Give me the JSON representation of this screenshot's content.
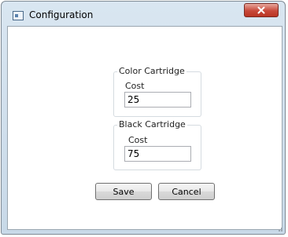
{
  "window": {
    "title": "Configuration"
  },
  "color_cartridge": {
    "legend": "Color Cartridge",
    "cost_label": "Cost",
    "cost_value": "25"
  },
  "black_cartridge": {
    "legend": "Black Cartridge",
    "cost_label": "Cost",
    "cost_value": "75"
  },
  "buttons": {
    "save": "Save",
    "cancel": "Cancel"
  },
  "icons": {
    "app": "app-window-icon",
    "close": "close-icon"
  }
}
